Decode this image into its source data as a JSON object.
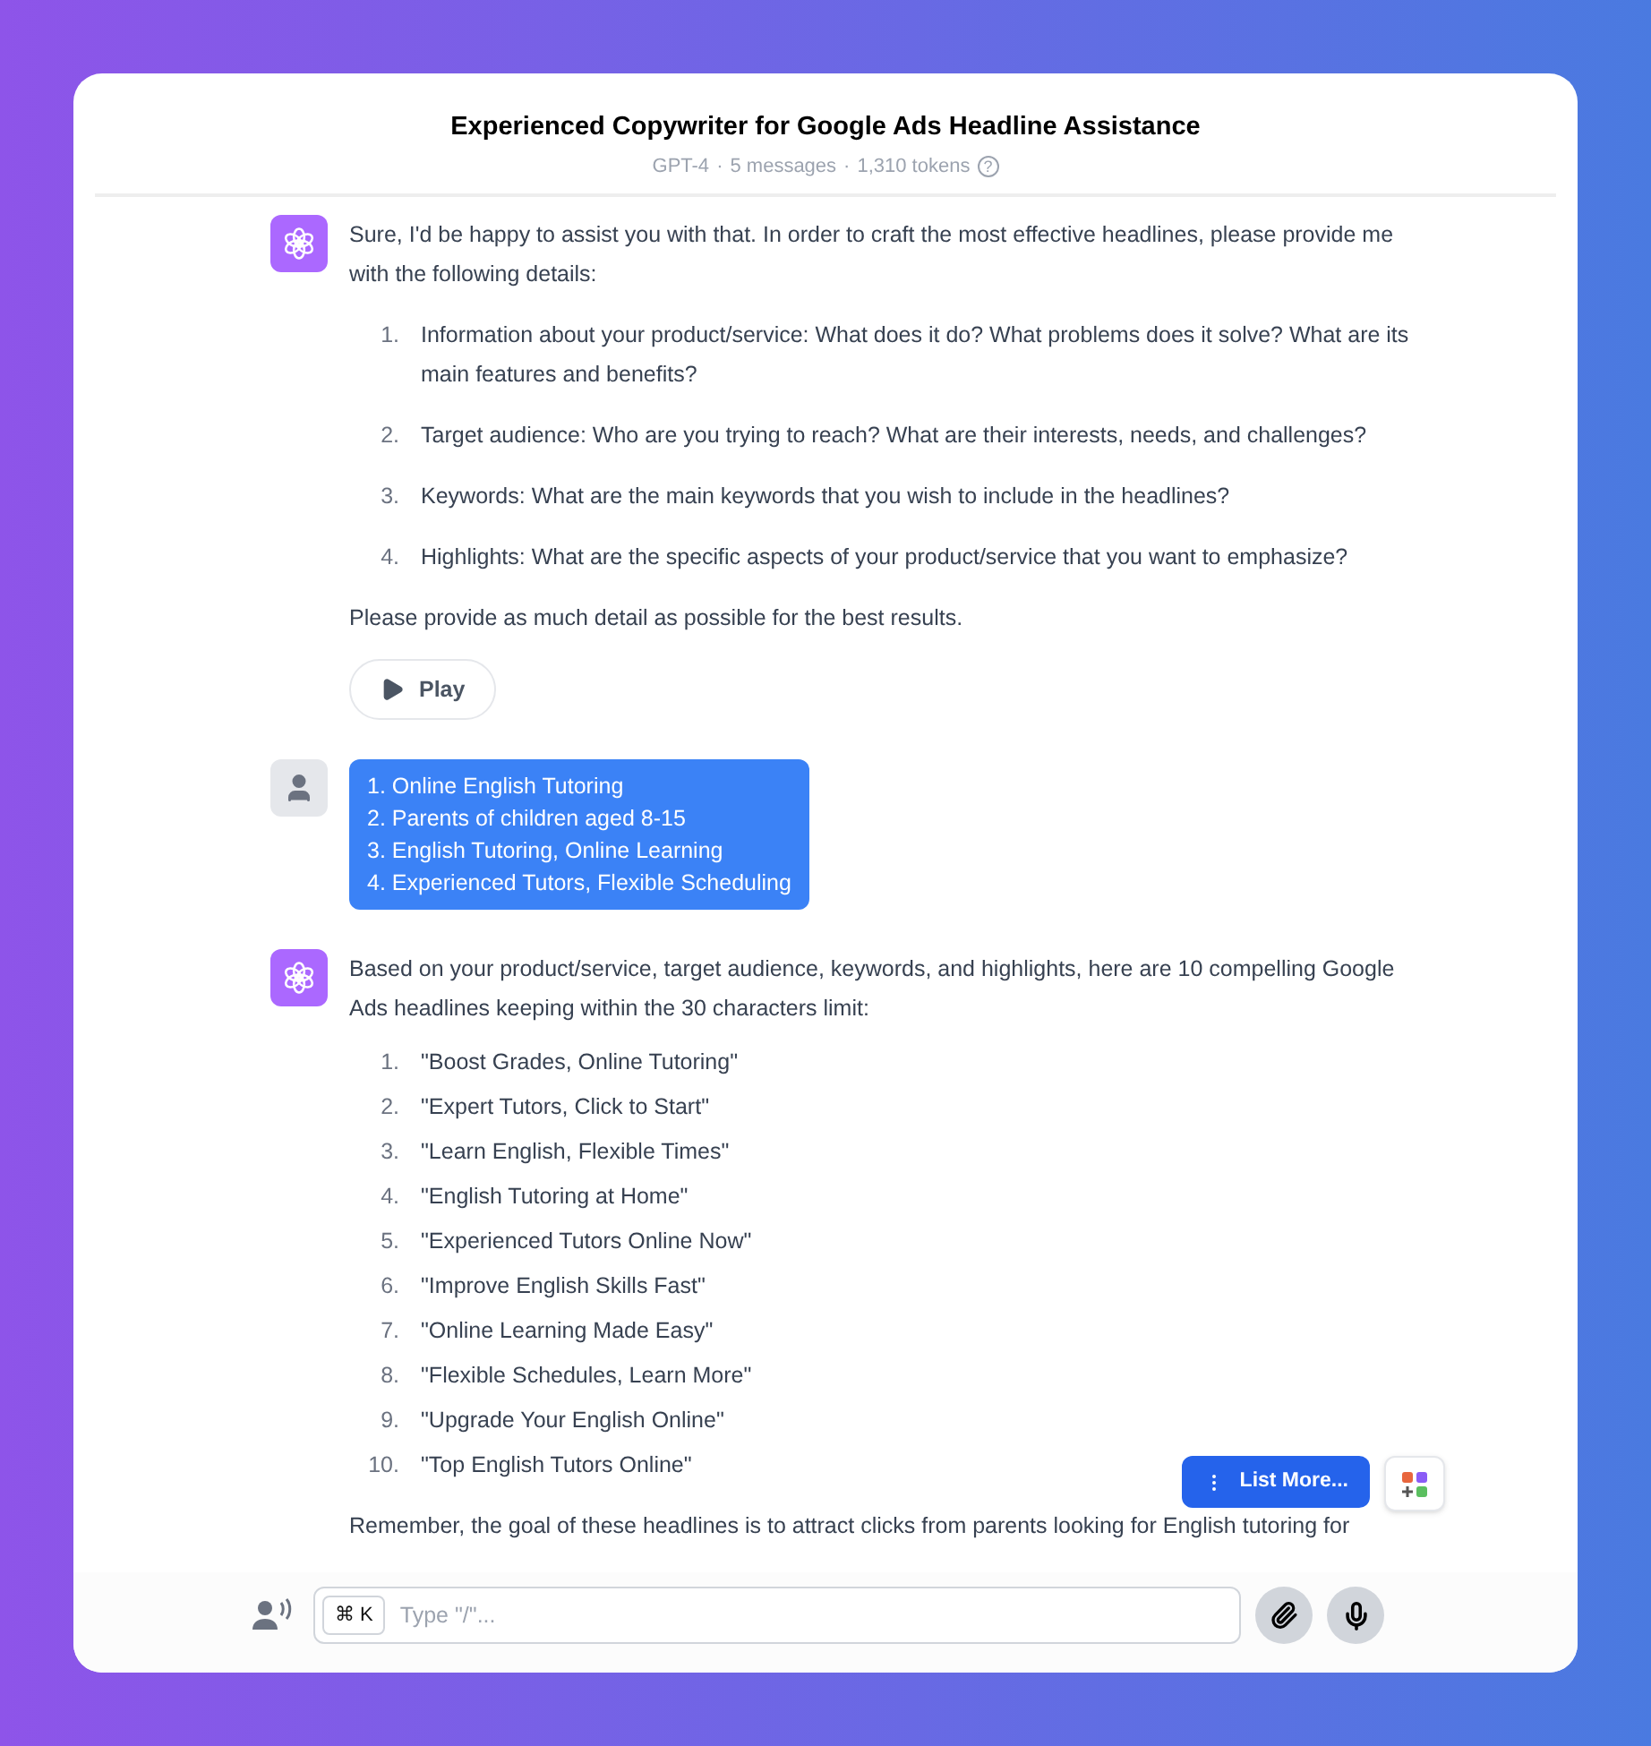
{
  "header": {
    "title": "Experienced Copywriter for Google Ads Headline Assistance",
    "model": "GPT-4",
    "messages": "5 messages",
    "tokens": "1,310 tokens",
    "help_icon": "?",
    "separator": "·"
  },
  "messages": [
    {
      "kind": "assistant",
      "intro": "Sure, I'd be happy to assist you with that. In order to craft the most effective headlines, please provide me with the following details:",
      "list": [
        {
          "number": "1.",
          "text": "Information about your product/service: What does it do? What problems does it solve? What are its main features and benefits?"
        },
        {
          "number": "2.",
          "text": "Target audience: Who are you trying to reach? What are their interests, needs, and challenges?"
        },
        {
          "number": "3.",
          "text": "Keywords: What are the main keywords that you wish to include in the headlines?"
        },
        {
          "number": "4.",
          "text": "Highlights: What are the specific aspects of your product/service that you want to emphasize?"
        }
      ],
      "outro": "Please provide as much detail as possible for the best results.",
      "play_button": "Play",
      "spaced": true
    },
    {
      "kind": "user",
      "lines": [
        "1. Online English Tutoring",
        "2. Parents of children aged 8-15",
        "3. English Tutoring, Online Learning",
        "4. Experienced Tutors, Flexible Scheduling"
      ]
    },
    {
      "kind": "assistant",
      "intro": "Based on your product/service, target audience, keywords, and highlights, here are 10 compelling Google Ads headlines keeping within the 30 characters limit:",
      "list": [
        {
          "number": "1.",
          "text": "\"Boost Grades, Online Tutoring\""
        },
        {
          "number": "2.",
          "text": "\"Expert Tutors, Click to Start\""
        },
        {
          "number": "3.",
          "text": "\"Learn English, Flexible Times\""
        },
        {
          "number": "4.",
          "text": "\"English Tutoring at Home\""
        },
        {
          "number": "5.",
          "text": "\"Experienced Tutors Online Now\""
        },
        {
          "number": "6.",
          "text": "\"Improve English Skills Fast\""
        },
        {
          "number": "7.",
          "text": "\"Online Learning Made Easy\""
        },
        {
          "number": "8.",
          "text": "\"Flexible Schedules, Learn More\""
        },
        {
          "number": "9.",
          "text": "\"Upgrade Your English Online\""
        },
        {
          "number": "10.",
          "text": "\"Top English Tutors Online\""
        }
      ],
      "outro": "Remember, the goal of these headlines is to attract clicks from parents looking for English tutoring for",
      "spaced": false
    }
  ],
  "list_more_button": "List More...",
  "composer": {
    "shortcut": "⌘ K",
    "placeholder": "Type \"/\"..."
  }
}
